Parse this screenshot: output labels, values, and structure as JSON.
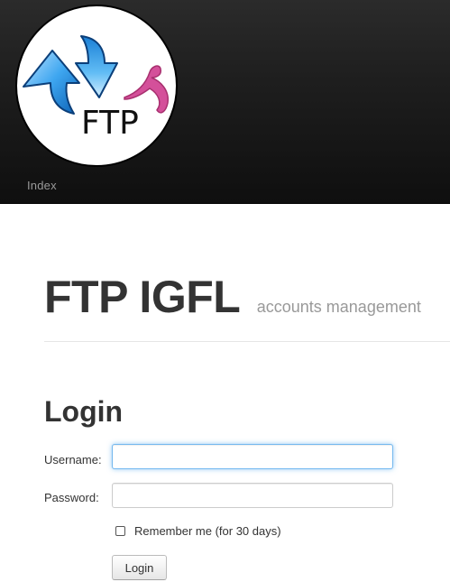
{
  "nav": {
    "logo_text": "FTP",
    "index_label": "Index"
  },
  "header": {
    "title": "FTP IGFL",
    "subtitle": "accounts management"
  },
  "login": {
    "title": "Login",
    "username_label": "Username:",
    "username_value": "",
    "password_label": "Password:",
    "password_value": "",
    "remember_label": "Remember me (for 30 days)",
    "remember_checked": false,
    "submit_label": "Login"
  },
  "colors": {
    "topbar": "#1e1e1e",
    "focus_glow": "#52a8ec",
    "logo_blue": "#1f8fe0",
    "logo_pink": "#d4509a"
  }
}
